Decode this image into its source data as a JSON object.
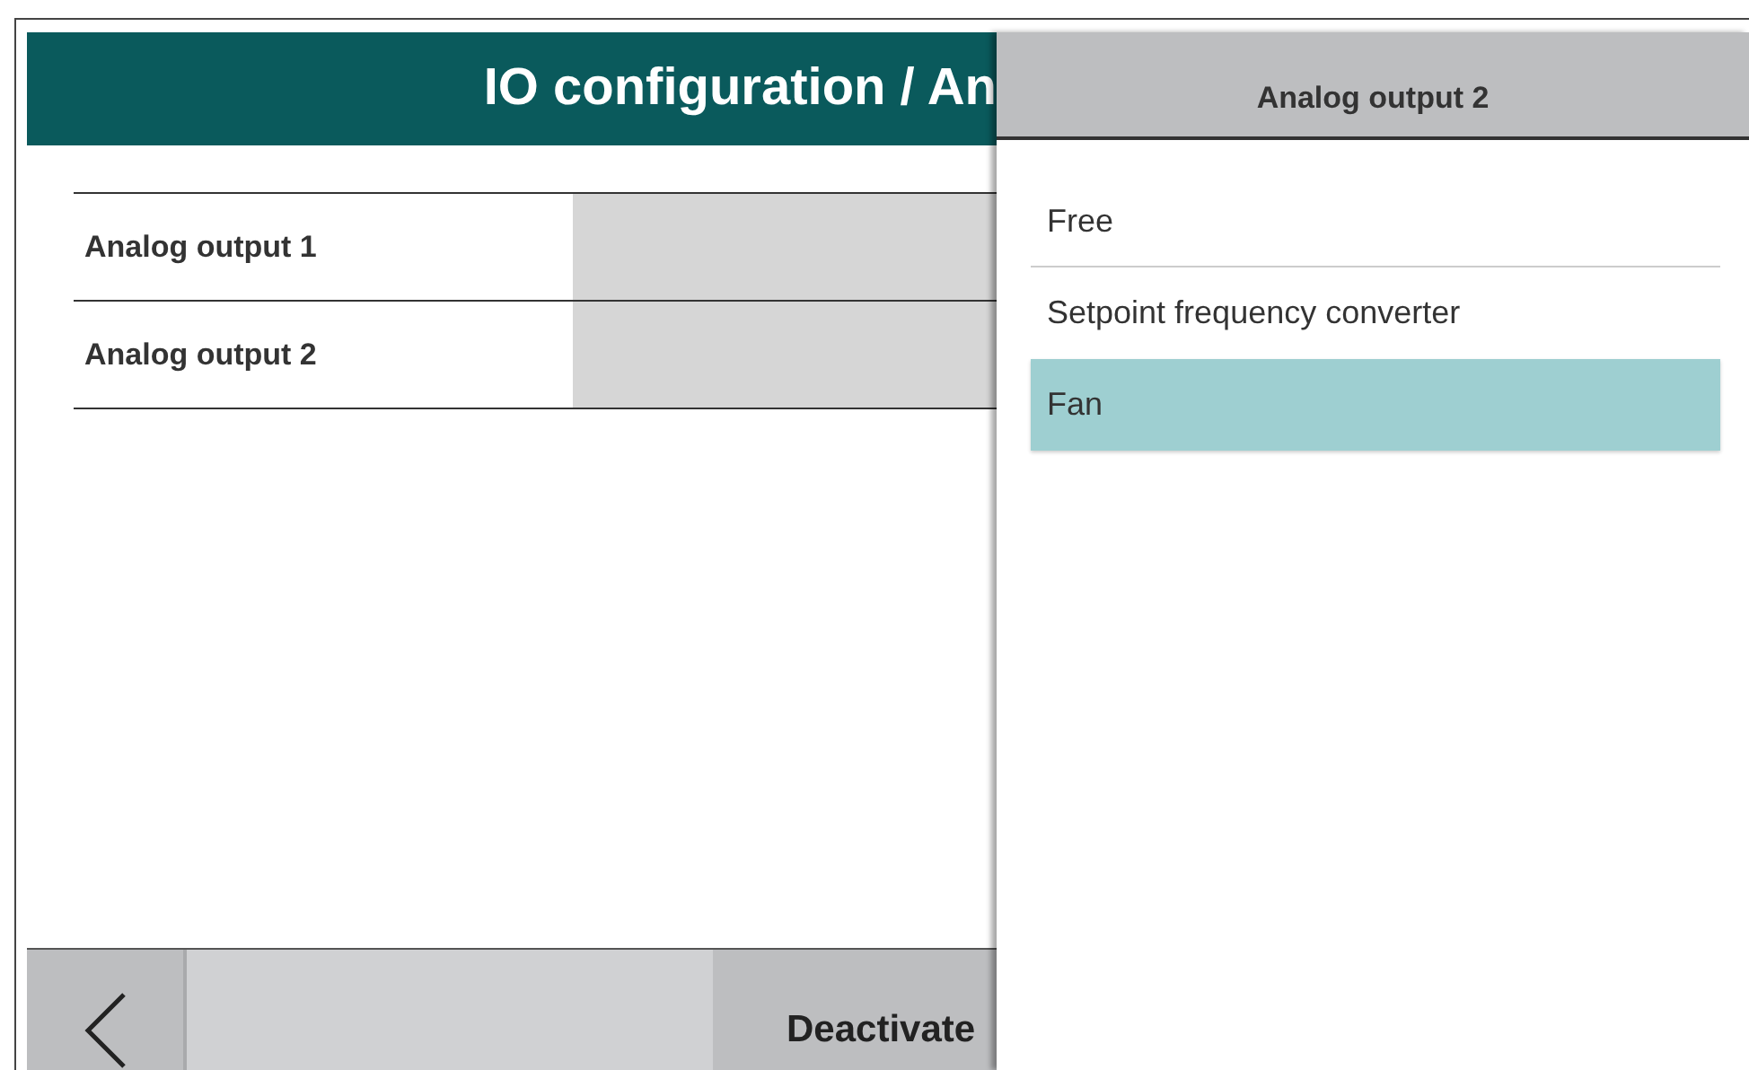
{
  "header": {
    "title": "IO configuration / An"
  },
  "rows": [
    {
      "label": "Analog output 1"
    },
    {
      "label": "Analog output 2"
    }
  ],
  "bottom_bar": {
    "action_button": "Deactivate"
  },
  "selection_panel": {
    "title": "Analog output 2",
    "options": [
      {
        "label": "Free",
        "selected": false
      },
      {
        "label": "Setpoint frequency converter",
        "selected": false
      },
      {
        "label": "Fan",
        "selected": true
      }
    ]
  }
}
